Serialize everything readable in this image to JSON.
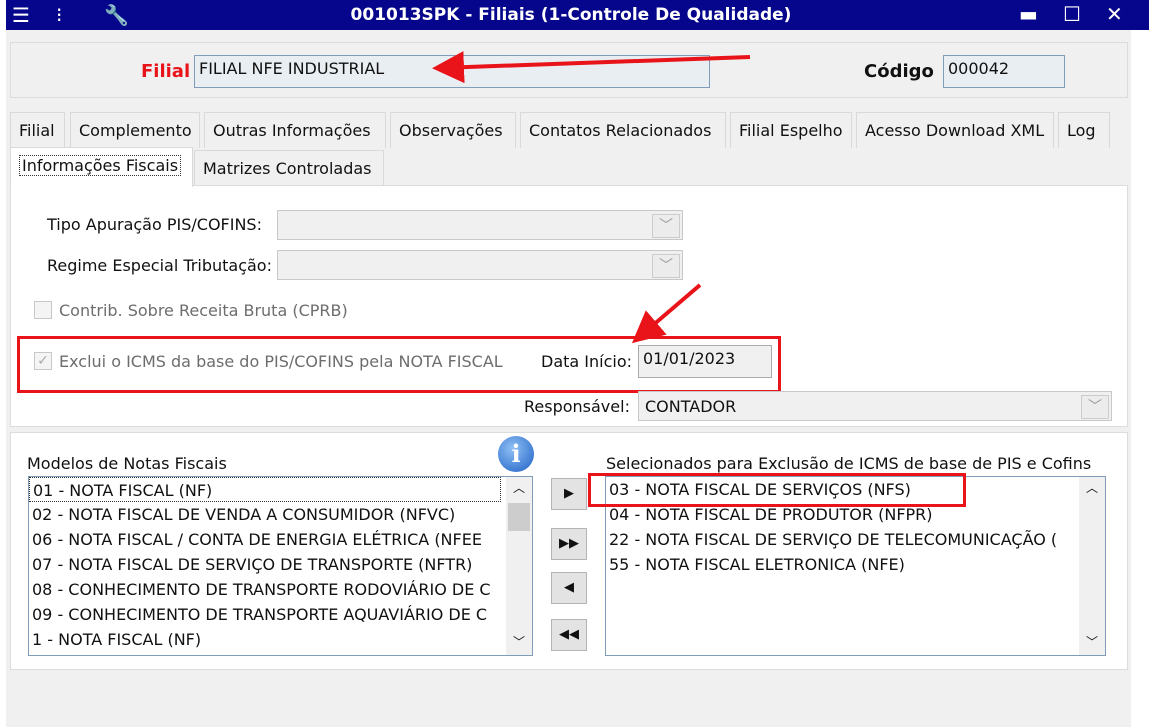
{
  "window": {
    "title": "001013SPK - Filiais (1-Controle De Qualidade)",
    "icons": [
      "menu-icon",
      "traffic-light-icon",
      "wrench-icon"
    ],
    "controls": [
      "minimize",
      "maximize",
      "close"
    ]
  },
  "header": {
    "filial_label": "Filial",
    "filial_value": "FILIAL NFE INDUSTRIAL",
    "codigo_label": "Código",
    "codigo_value": "000042"
  },
  "tabs_row1": [
    "Filial",
    "Complemento",
    "Outras Informações",
    "Observações",
    "Contatos Relacionados",
    "Filial Espelho",
    "Acesso Download XML",
    "Log"
  ],
  "tabs_row2": [
    "Informações Fiscais",
    "Matrizes Controladas"
  ],
  "active_tab": "Informações Fiscais",
  "form": {
    "tipo_apuracao_label": "Tipo Apuração PIS/COFINS:",
    "tipo_apuracao_value": "",
    "regime_label": "Regime Especial Tributação:",
    "regime_value": "",
    "cprb_label": "Contrib. Sobre Receita Bruta (CPRB)",
    "cprb_checked": false,
    "exclui_label": "Exclui o ICMS da base do PIS/COFINS pela NOTA FISCAL",
    "exclui_checked": true,
    "data_inicio_label": "Data Início:",
    "data_inicio_value": "01/01/2023",
    "responsavel_label": "Responsável:",
    "responsavel_value": "CONTADOR"
  },
  "modelos": {
    "label": "Modelos de Notas Fiscais",
    "items": [
      "01  - NOTA FISCAL (NF)",
      "02  - NOTA FISCAL DE VENDA A CONSUMIDOR (NFVC)",
      "06  - NOTA FISCAL / CONTA DE ENERGIA ELÉTRICA (NFEE",
      "07  - NOTA FISCAL DE SERVIÇO DE TRANSPORTE (NFTR)",
      "08  - CONHECIMENTO DE TRANSPORTE RODOVIÁRIO DE C",
      "09  - CONHECIMENTO DE TRANSPORTE AQUAVIÁRIO DE C",
      "1   - NOTA FISCAL (NF)"
    ]
  },
  "selecionados": {
    "label": "Selecionados para Exclusão de ICMS de base de PIS e Cofins",
    "items": [
      "03  - NOTA FISCAL DE SERVIÇOS (NFS)",
      "04  - NOTA FISCAL DE PRODUTOR (NFPR)",
      "22  - NOTA FISCAL DE SERVIÇO DE TELECOMUNICAÇÃO (",
      "55  - NOTA FISCAL ELETRONICA (NFE)"
    ]
  },
  "move_buttons": [
    "▶",
    "▶▶",
    "◀",
    "◀◀"
  ],
  "colors": {
    "titlebar": "#06068c",
    "highlight": "#e8141a",
    "required_label": "#e8141a"
  }
}
